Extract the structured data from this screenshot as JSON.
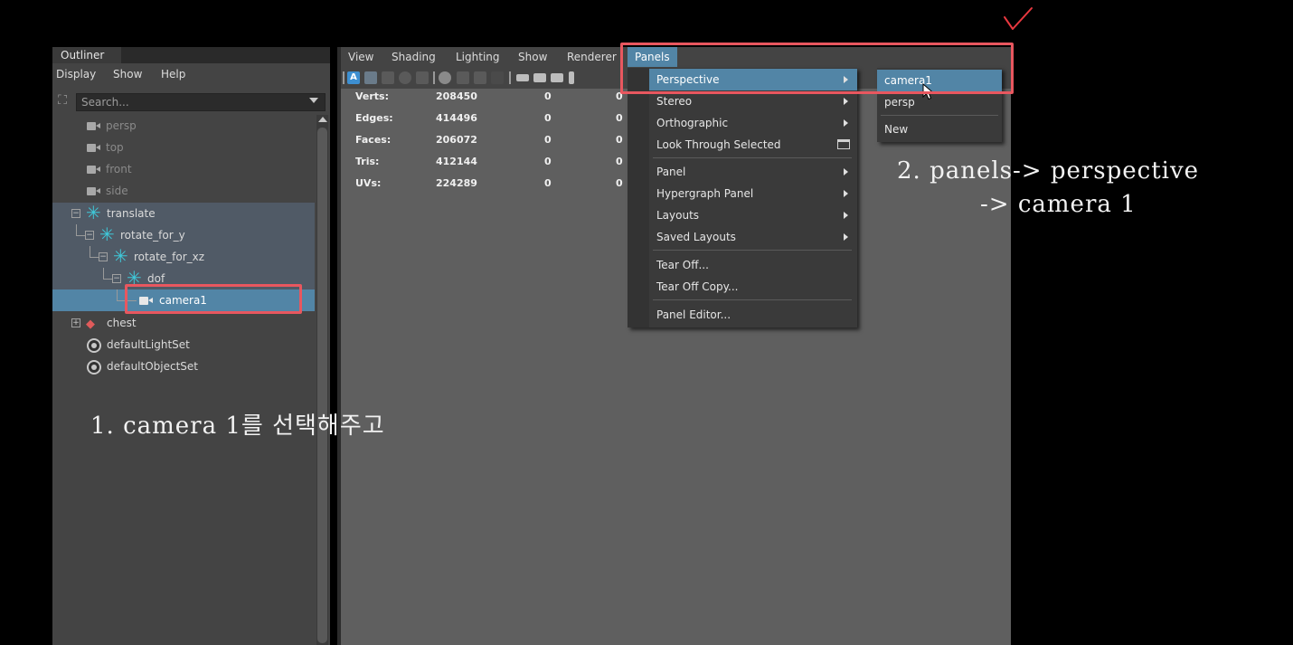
{
  "outliner": {
    "tab": "Outliner",
    "menu": [
      "Display",
      "Show",
      "Help"
    ],
    "search_placeholder": "Search...",
    "items": {
      "persp": "persp",
      "top": "top",
      "front": "front",
      "side": "side",
      "translate": "translate",
      "rotate_for_y": "rotate_for_y",
      "rotate_for_xz": "rotate_for_xz",
      "dof": "dof",
      "camera1": "camera1",
      "chest": "chest",
      "default_light_set": "defaultLightSet",
      "default_object_set": "defaultObjectSet"
    }
  },
  "viewport": {
    "menu": [
      "View",
      "Shading",
      "Lighting",
      "Show",
      "Renderer",
      "Panels"
    ],
    "active_menu": "Panels",
    "toolbar_letter": "A",
    "hud": [
      {
        "label": "Verts:",
        "value": "208450",
        "c2": "0",
        "c3": "0"
      },
      {
        "label": "Edges:",
        "value": "414496",
        "c2": "0",
        "c3": "0"
      },
      {
        "label": "Faces:",
        "value": "206072",
        "c2": "0",
        "c3": "0"
      },
      {
        "label": "Tris:",
        "value": "412144",
        "c2": "0",
        "c3": "0"
      },
      {
        "label": "UVs:",
        "value": "224289",
        "c2": "0",
        "c3": "0"
      }
    ]
  },
  "panels_menu": {
    "items": [
      "Perspective",
      "Stereo",
      "Orthographic",
      "Look Through Selected",
      "Panel",
      "Hypergraph Panel",
      "Layouts",
      "Saved Layouts",
      "Tear Off...",
      "Tear Off Copy...",
      "Panel Editor..."
    ],
    "highlighted": "Perspective"
  },
  "perspective_submenu": {
    "items": [
      "camera1",
      "persp",
      "New"
    ],
    "highlighted": "camera1"
  },
  "annotations": {
    "step1": "1. camera 1를 선택해주고",
    "step2_line1": "2. panels-> perspective",
    "step2_line2": "-> camera 1",
    "highlight_color": "#e8575f"
  },
  "colors": {
    "selection": "#5285a6",
    "group_highlight": "#505a66",
    "transform_icon": "#3fc7d8"
  }
}
